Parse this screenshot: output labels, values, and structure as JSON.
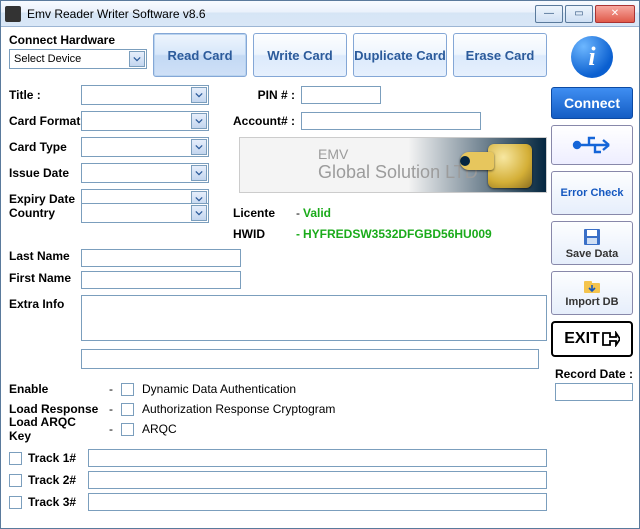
{
  "window": {
    "title": "Emv Reader Writer Software v8.6"
  },
  "hardware": {
    "label": "Connect Hardware",
    "placeholder": "Select Device"
  },
  "buttons": {
    "read": "Read Card",
    "write": "Write Card",
    "duplicate": "Duplicate Card",
    "erase": "Erase Card",
    "connect": "Connect",
    "error_check": "Error Check",
    "save_data": "Save Data",
    "import_db": "Import DB",
    "exit": "EXIT"
  },
  "labels": {
    "title": "Title :",
    "pin": "PIN # :",
    "card_format": "Card Format",
    "account": "Account# :",
    "card_type": "Card Type",
    "issue_date": "Issue Date",
    "expiry_date": "Expiry Date",
    "country": "Country",
    "last_name": "Last Name",
    "first_name": "First Name",
    "extra_info": "Extra Info",
    "enable": "Enable",
    "load_response": "Load Response",
    "load_arqc": "Load ARQC Key",
    "record_date": "Record Date :",
    "track1": "Track 1#",
    "track2": "Track 2#",
    "track3": "Track 3#"
  },
  "banner": {
    "line1": "EMV",
    "line2": "Global Solution LTD"
  },
  "license": {
    "label": "Licente",
    "status": "Valid",
    "hwid_label": "HWID",
    "hwid": "HYFREDSW3532DFGBD56HU009"
  },
  "options": {
    "dda": "Dynamic Data Authentication",
    "arc": "Authorization Response Cryptogram",
    "arqc": "ARQC"
  },
  "values": {
    "title": "",
    "pin": "",
    "card_format": "",
    "account": "",
    "card_type": "",
    "issue_date": "",
    "expiry_date": "",
    "country": "",
    "last_name": "",
    "first_name": "",
    "extra_info": "",
    "longline": "",
    "track1": "",
    "track2": "",
    "track3": "",
    "record_date": ""
  }
}
